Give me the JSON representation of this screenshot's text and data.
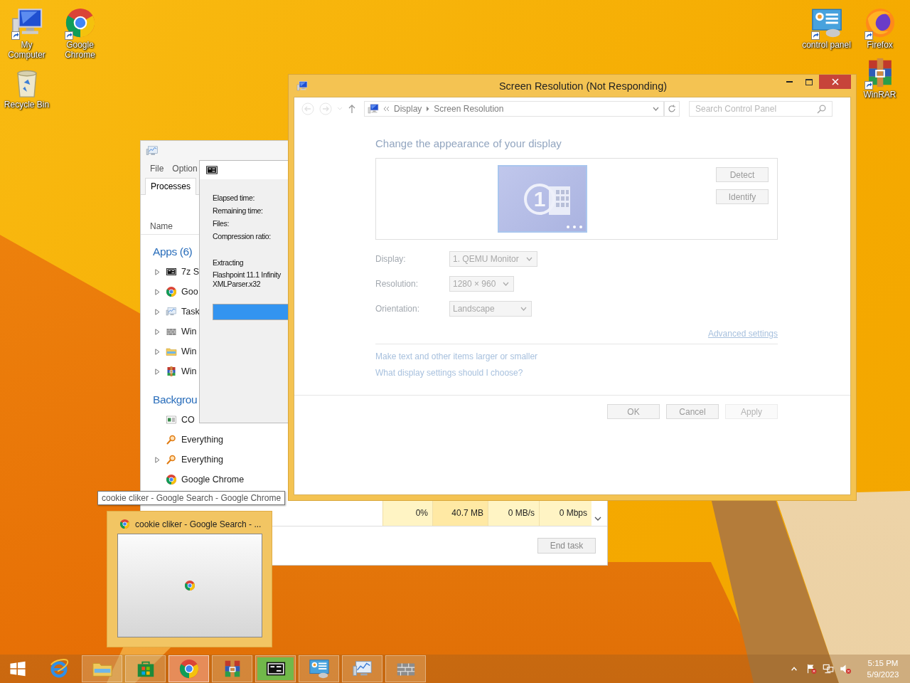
{
  "desktop_icons_left": [
    {
      "label": "My Computer",
      "kind": "computer",
      "shortcut": true
    },
    {
      "label": "Google Chrome",
      "kind": "chrome",
      "shortcut": true
    },
    {
      "label": "Recycle Bin",
      "kind": "recycle",
      "shortcut": false
    }
  ],
  "desktop_icons_right": [
    {
      "label": "control panel",
      "kind": "control",
      "shortcut": true
    },
    {
      "label": "Firefox",
      "kind": "firefox",
      "shortcut": true
    },
    {
      "label": "WinRAR",
      "kind": "winrar",
      "shortcut": true
    }
  ],
  "task_manager": {
    "menu": [
      "File",
      "Option"
    ],
    "tabs": [
      {
        "label": "Processes",
        "selected": true
      }
    ],
    "column_header": "Name",
    "groups": [
      {
        "title": "Apps (6)",
        "items": [
          {
            "name": "7z S",
            "kind": "sevenzip",
            "expandable": true
          },
          {
            "name": "Goo",
            "kind": "chrome",
            "expandable": true
          },
          {
            "name": "Task",
            "kind": "taskmgr",
            "expandable": true
          },
          {
            "name": "Win",
            "kind": "wall",
            "expandable": true
          },
          {
            "name": "Win",
            "kind": "explorer",
            "expandable": true
          },
          {
            "name": "Win",
            "kind": "winrar",
            "expandable": true
          }
        ]
      },
      {
        "title": "Backgrou",
        "items": [
          {
            "name": "CO",
            "kind": "com",
            "expandable": false
          },
          {
            "name": "Everything",
            "kind": "everything",
            "expandable": false
          },
          {
            "name": "Everything",
            "kind": "everything",
            "expandable": true
          },
          {
            "name": "Google Chrome",
            "kind": "chrome",
            "expandable": false
          }
        ]
      }
    ],
    "selected_row": [
      {
        "text": "0%",
        "color": "#fff4c4"
      },
      {
        "text": "40.7 MB",
        "color": "#ffe9a4"
      },
      {
        "text": "0 MB/s",
        "color": "#fff4c4"
      },
      {
        "text": "0 Mbps",
        "color": "#fff4c4"
      }
    ],
    "end_task": "End task"
  },
  "seven_zip": {
    "labels": [
      "Elapsed time:",
      "Remaining time:",
      "Files:",
      "Compression ratio:"
    ],
    "status": "Extracting",
    "file_lines": [
      "Flashpoint 11.1 Infinity",
      "XMLParser.x32"
    ],
    "level": 1
  },
  "screen_resolution": {
    "title": "Screen Resolution (Not Responding)",
    "breadcrumb": [
      "Display",
      "Screen Resolution"
    ],
    "search": {
      "placeholder": "Search Control Panel"
    },
    "heading": "Change the appearance of your display",
    "monitor_number": "1",
    "side_buttons": [
      "Detect",
      "Identify"
    ],
    "settings": [
      {
        "label": "Display:",
        "value": "1. QEMU Monitor"
      },
      {
        "label": "Resolution:",
        "value": "1280 × 960"
      },
      {
        "label": "Orientation:",
        "value": "Landscape"
      }
    ],
    "advanced_link": "Advanced settings",
    "links": [
      "Make text and other items larger or smaller",
      "What display settings should I choose?"
    ],
    "buttons": [
      {
        "label": "OK",
        "disabled": false
      },
      {
        "label": "Cancel",
        "disabled": false
      },
      {
        "label": "Apply",
        "disabled": true
      }
    ]
  },
  "tooltip": "cookie cliker - Google Search - Google Chrome",
  "thumbnail": {
    "title": "cookie cliker - Google Search - ..."
  },
  "taskbar": {
    "items": [
      {
        "kind": "ie",
        "running": false,
        "selected": false
      },
      {
        "kind": "explorer",
        "running": true,
        "selected": false
      },
      {
        "kind": "store",
        "running": true,
        "selected": false
      },
      {
        "kind": "chrome",
        "running": true,
        "selected": true
      },
      {
        "kind": "winrar",
        "running": true,
        "selected": false
      },
      {
        "kind": "sevenzip",
        "running": true,
        "selected": false,
        "level": 1
      },
      {
        "kind": "control",
        "running": true,
        "selected": false
      },
      {
        "kind": "taskmgr",
        "running": true,
        "selected": false
      },
      {
        "kind": "wall",
        "running": true,
        "selected": false
      }
    ],
    "clock": {
      "time": "5:15 PM",
      "date": "5/9/2023"
    }
  }
}
